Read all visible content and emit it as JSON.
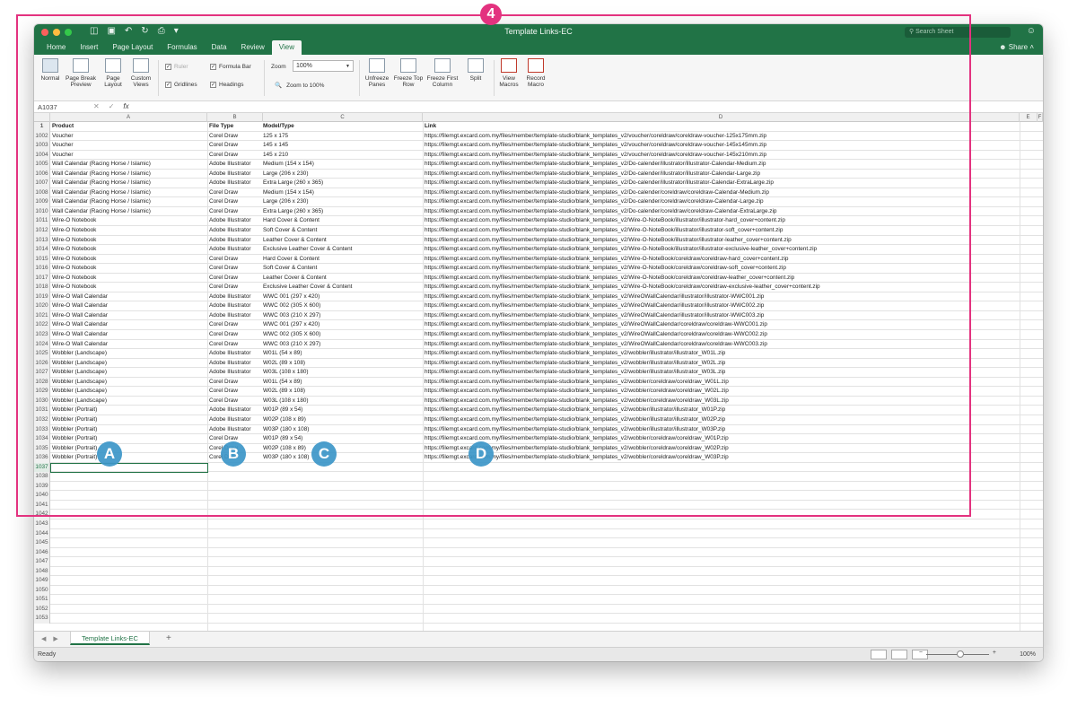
{
  "window": {
    "title": "Template Links-EC",
    "search_placeholder": "Search Sheet",
    "share_label": "Share"
  },
  "ribbon": {
    "tabs": [
      "Home",
      "Insert",
      "Page Layout",
      "Formulas",
      "Data",
      "Review",
      "View"
    ],
    "active_tab": "View",
    "view_buttons": [
      {
        "label": "Normal"
      },
      {
        "label": "Page Break Preview"
      },
      {
        "label": "Page Layout"
      },
      {
        "label": "Custom Views"
      }
    ],
    "checkboxes": [
      {
        "label": "Ruler",
        "checked": true,
        "disabled": true
      },
      {
        "label": "Formula Bar",
        "checked": true
      },
      {
        "label": "Gridlines",
        "checked": true
      },
      {
        "label": "Headings",
        "checked": true
      }
    ],
    "zoom_label": "Zoom",
    "zoom_value": "100%",
    "zoom_to_100": "Zoom to 100%",
    "window_buttons": [
      {
        "label": "Unfreeze Panes"
      },
      {
        "label": "Freeze Top Row"
      },
      {
        "label": "Freeze First Column"
      },
      {
        "label": "Split"
      }
    ],
    "macro_buttons": [
      {
        "label": "View Macros"
      },
      {
        "label": "Record Macro"
      }
    ]
  },
  "formula_bar": {
    "name_box": "A1037",
    "fx": "fx"
  },
  "columns": [
    "A",
    "B",
    "C",
    "D",
    "E",
    "F"
  ],
  "header_row": {
    "rownum": "1",
    "a": "Product",
    "b": "File Type",
    "c": "Model/Type",
    "d": "Link"
  },
  "rows": [
    {
      "n": "1002",
      "a": "Voucher",
      "b": "Corel Draw",
      "c": "125 x 175",
      "d": "https://filemgt.excard.com.my/files/member/template-studio/blank_templates_v2/voucher/coreldraw/coreldraw-voucher-125x175mm.zip"
    },
    {
      "n": "1003",
      "a": "Voucher",
      "b": "Corel Draw",
      "c": "145 x 145",
      "d": "https://filemgt.excard.com.my/files/member/template-studio/blank_templates_v2/voucher/coreldraw/coreldraw-voucher-145x145mm.zip"
    },
    {
      "n": "1004",
      "a": "Voucher",
      "b": "Corel Draw",
      "c": "145 x 210",
      "d": "https://filemgt.excard.com.my/files/member/template-studio/blank_templates_v2/voucher/coreldraw/coreldraw-voucher-145x210mm.zip"
    },
    {
      "n": "1005",
      "a": "Wall Calendar (Racing Horse / Islamic)",
      "b": "Adobe Illustrator",
      "c": "Medium (154 x 154)",
      "d": "https://filemgt.excard.com.my/files/member/template-studio/blank_templates_v2/Do-calender/illustrator/illustrator-Calendar-Medium.zip"
    },
    {
      "n": "1006",
      "a": "Wall Calendar (Racing Horse / Islamic)",
      "b": "Adobe Illustrator",
      "c": "Large (206 x 230)",
      "d": "https://filemgt.excard.com.my/files/member/template-studio/blank_templates_v2/Do-calender/illustrator/illustrator-Calendar-Large.zip"
    },
    {
      "n": "1007",
      "a": "Wall Calendar (Racing Horse / Islamic)",
      "b": "Adobe Illustrator",
      "c": "Extra Large (260 x 365)",
      "d": "https://filemgt.excard.com.my/files/member/template-studio/blank_templates_v2/Do-calender/illustrator/illustrator-Calendar-ExtraLarge.zip"
    },
    {
      "n": "1008",
      "a": "Wall Calendar (Racing Horse / Islamic)",
      "b": "Corel Draw",
      "c": "Medium (154 x 154)",
      "d": "https://filemgt.excard.com.my/files/member/template-studio/blank_templates_v2/Do-calender/coreldraw/coreldraw-Calendar-Medium.zip"
    },
    {
      "n": "1009",
      "a": "Wall Calendar (Racing Horse / Islamic)",
      "b": "Corel Draw",
      "c": "Large (206 x 230)",
      "d": "https://filemgt.excard.com.my/files/member/template-studio/blank_templates_v2/Do-calender/coreldraw/coreldraw-Calendar-Large.zip"
    },
    {
      "n": "1010",
      "a": "Wall Calendar (Racing Horse / Islamic)",
      "b": "Corel Draw",
      "c": "Extra Large (260 x 365)",
      "d": "https://filemgt.excard.com.my/files/member/template-studio/blank_templates_v2/Do-calender/coreldraw/coreldraw-Calendar-ExtraLarge.zip"
    },
    {
      "n": "1011",
      "a": "Wire-O Notebook",
      "b": "Adobe Illustrator",
      "c": "Hard Cover & Content",
      "d": "https://filemgt.excard.com.my/files/member/template-studio/blank_templates_v2/Wire-O-NoteBook/illustrator/illustrator-hard_cover+content.zip"
    },
    {
      "n": "1012",
      "a": "Wire-O Notebook",
      "b": "Adobe Illustrator",
      "c": "Soft Cover & Content",
      "d": "https://filemgt.excard.com.my/files/member/template-studio/blank_templates_v2/Wire-O-NoteBook/illustrator/illustrator-soft_cover+content.zip"
    },
    {
      "n": "1013",
      "a": "Wire-O Notebook",
      "b": "Adobe Illustrator",
      "c": "Leather Cover & Content",
      "d": "https://filemgt.excard.com.my/files/member/template-studio/blank_templates_v2/Wire-O-NoteBook/illustrator/illustrator-leather_cover+content.zip"
    },
    {
      "n": "1014",
      "a": "Wire-O Notebook",
      "b": "Adobe Illustrator",
      "c": "Exclusive Leather Cover & Content",
      "d": "https://filemgt.excard.com.my/files/member/template-studio/blank_templates_v2/Wire-O-NoteBook/illustrator/illustrator-exclusive-leather_cover+content.zip"
    },
    {
      "n": "1015",
      "a": "Wire-O Notebook",
      "b": "Corel Draw",
      "c": "Hard Cover & Content",
      "d": "https://filemgt.excard.com.my/files/member/template-studio/blank_templates_v2/Wire-O-NoteBook/coreldraw/coreldraw-hard_cover+content.zip"
    },
    {
      "n": "1016",
      "a": "Wire-O Notebook",
      "b": "Corel Draw",
      "c": "Soft Cover & Content",
      "d": "https://filemgt.excard.com.my/files/member/template-studio/blank_templates_v2/Wire-O-NoteBook/coreldraw/coreldraw-soft_cover+content.zip"
    },
    {
      "n": "1017",
      "a": "Wire-O Notebook",
      "b": "Corel Draw",
      "c": "Leather Cover & Content",
      "d": "https://filemgt.excard.com.my/files/member/template-studio/blank_templates_v2/Wire-O-NoteBook/coreldraw/coreldraw-leather_cover+content.zip"
    },
    {
      "n": "1018",
      "a": "Wire-O Notebook",
      "b": "Corel Draw",
      "c": "Exclusive Leather Cover & Content",
      "d": "https://filemgt.excard.com.my/files/member/template-studio/blank_templates_v2/Wire-O-NoteBook/coreldraw/coreldraw-exclusive-leather_cover+content.zip"
    },
    {
      "n": "1019",
      "a": "Wire-O Wall Calendar",
      "b": "Adobe Illustrator",
      "c": "WWC 001 (297 x 420)",
      "d": "https://filemgt.excard.com.my/files/member/template-studio/blank_templates_v2/WireOWallCalendar/illustrator/illustrator-WWC001.zip"
    },
    {
      "n": "1020",
      "a": "Wire-O Wall Calendar",
      "b": "Adobe Illustrator",
      "c": "WWC 002 (305 X 600)",
      "d": "https://filemgt.excard.com.my/files/member/template-studio/blank_templates_v2/WireOWallCalendar/illustrator/illustrator-WWC002.zip"
    },
    {
      "n": "1021",
      "a": "Wire-O Wall Calendar",
      "b": "Adobe Illustrator",
      "c": "WWC 003 (210 X 297)",
      "d": "https://filemgt.excard.com.my/files/member/template-studio/blank_templates_v2/WireOWallCalendar/illustrator/illustrator-WWC003.zip"
    },
    {
      "n": "1022",
      "a": "Wire-O Wall Calendar",
      "b": "Corel Draw",
      "c": "WWC 001 (297 x 420)",
      "d": "https://filemgt.excard.com.my/files/member/template-studio/blank_templates_v2/WireOWallCalendar/coreldraw/coreldraw-WWC001.zip"
    },
    {
      "n": "1023",
      "a": "Wire-O Wall Calendar",
      "b": "Corel Draw",
      "c": "WWC 002 (305 X 600)",
      "d": "https://filemgt.excard.com.my/files/member/template-studio/blank_templates_v2/WireOWallCalendar/coreldraw/coreldraw-WWC002.zip"
    },
    {
      "n": "1024",
      "a": "Wire-O Wall Calendar",
      "b": "Corel Draw",
      "c": "WWC 003 (210 X 297)",
      "d": "https://filemgt.excard.com.my/files/member/template-studio/blank_templates_v2/WireOWallCalendar/coreldraw/coreldraw-WWC003.zip"
    },
    {
      "n": "1025",
      "a": "Wobbler (Landscape)",
      "b": "Adobe Illustrator",
      "c": "W01L (54 x 89)",
      "d": "https://filemgt.excard.com.my/files/member/template-studio/blank_templates_v2/wobbler/illustrator/illustrator_W01L.zip"
    },
    {
      "n": "1026",
      "a": "Wobbler (Landscape)",
      "b": "Adobe Illustrator",
      "c": "W02L (89 x 108)",
      "d": "https://filemgt.excard.com.my/files/member/template-studio/blank_templates_v2/wobbler/illustrator/illustrator_W02L.zip"
    },
    {
      "n": "1027",
      "a": "Wobbler (Landscape)",
      "b": "Adobe Illustrator",
      "c": "W03L (108 x 180)",
      "d": "https://filemgt.excard.com.my/files/member/template-studio/blank_templates_v2/wobbler/illustrator/illustrator_W03L.zip"
    },
    {
      "n": "1028",
      "a": "Wobbler (Landscape)",
      "b": "Corel Draw",
      "c": "W01L (54 x 89)",
      "d": "https://filemgt.excard.com.my/files/member/template-studio/blank_templates_v2/wobbler/coreldraw/coreldraw_W01L.zip"
    },
    {
      "n": "1029",
      "a": "Wobbler (Landscape)",
      "b": "Corel Draw",
      "c": "W02L (89 x 108)",
      "d": "https://filemgt.excard.com.my/files/member/template-studio/blank_templates_v2/wobbler/coreldraw/coreldraw_W02L.zip"
    },
    {
      "n": "1030",
      "a": "Wobbler (Landscape)",
      "b": "Corel Draw",
      "c": "W03L (108 x 180)",
      "d": "https://filemgt.excard.com.my/files/member/template-studio/blank_templates_v2/wobbler/coreldraw/coreldraw_W03L.zip"
    },
    {
      "n": "1031",
      "a": "Wobbler (Portrait)",
      "b": "Adobe Illustrator",
      "c": "W01P (89 x 54)",
      "d": "https://filemgt.excard.com.my/files/member/template-studio/blank_templates_v2/wobbler/illustrator/illustrator_W01P.zip"
    },
    {
      "n": "1032",
      "a": "Wobbler (Portrait)",
      "b": "Adobe Illustrator",
      "c": "W02P (108 x 89)",
      "d": "https://filemgt.excard.com.my/files/member/template-studio/blank_templates_v2/wobbler/illustrator/illustrator_W02P.zip"
    },
    {
      "n": "1033",
      "a": "Wobbler (Portrait)",
      "b": "Adobe Illustrator",
      "c": "W03P (180 x 108)",
      "d": "https://filemgt.excard.com.my/files/member/template-studio/blank_templates_v2/wobbler/illustrator/illustrator_W03P.zip"
    },
    {
      "n": "1034",
      "a": "Wobbler (Portrait)",
      "b": "Corel Draw",
      "c": "W01P (89 x 54)",
      "d": "https://filemgt.excard.com.my/files/member/template-studio/blank_templates_v2/wobbler/coreldraw/coreldraw_W01P.zip"
    },
    {
      "n": "1035",
      "a": "Wobbler (Portrait)",
      "b": "Corel Draw",
      "c": "W02P (108 x 89)",
      "d": "https://filemgt.excard.com.my/files/member/template-studio/blank_templates_v2/wobbler/coreldraw/coreldraw_W02P.zip"
    },
    {
      "n": "1036",
      "a": "Wobbler (Portrait)",
      "b": "Corel Draw",
      "c": "W03P (180 x 108)",
      "d": "https://filemgt.excard.com.my/files/member/template-studio/blank_templates_v2/wobbler/coreldraw/coreldraw_W03P.zip"
    }
  ],
  "empty_rows": [
    "1037",
    "1038",
    "1039",
    "1040",
    "1041",
    "1042",
    "1043",
    "1044",
    "1045",
    "1046",
    "1047",
    "1048",
    "1049",
    "1050",
    "1051",
    "1052",
    "1053"
  ],
  "sheet_tab": "Template Links-EC",
  "status": {
    "ready": "Ready",
    "zoom": "100%"
  },
  "annotations": {
    "box": "4",
    "a": "A",
    "b": "B",
    "c": "C",
    "d": "D"
  },
  "colors": {
    "excel_green": "#217346",
    "annotation_pink": "#e3327f",
    "annotation_blue": "#3c96c8"
  }
}
